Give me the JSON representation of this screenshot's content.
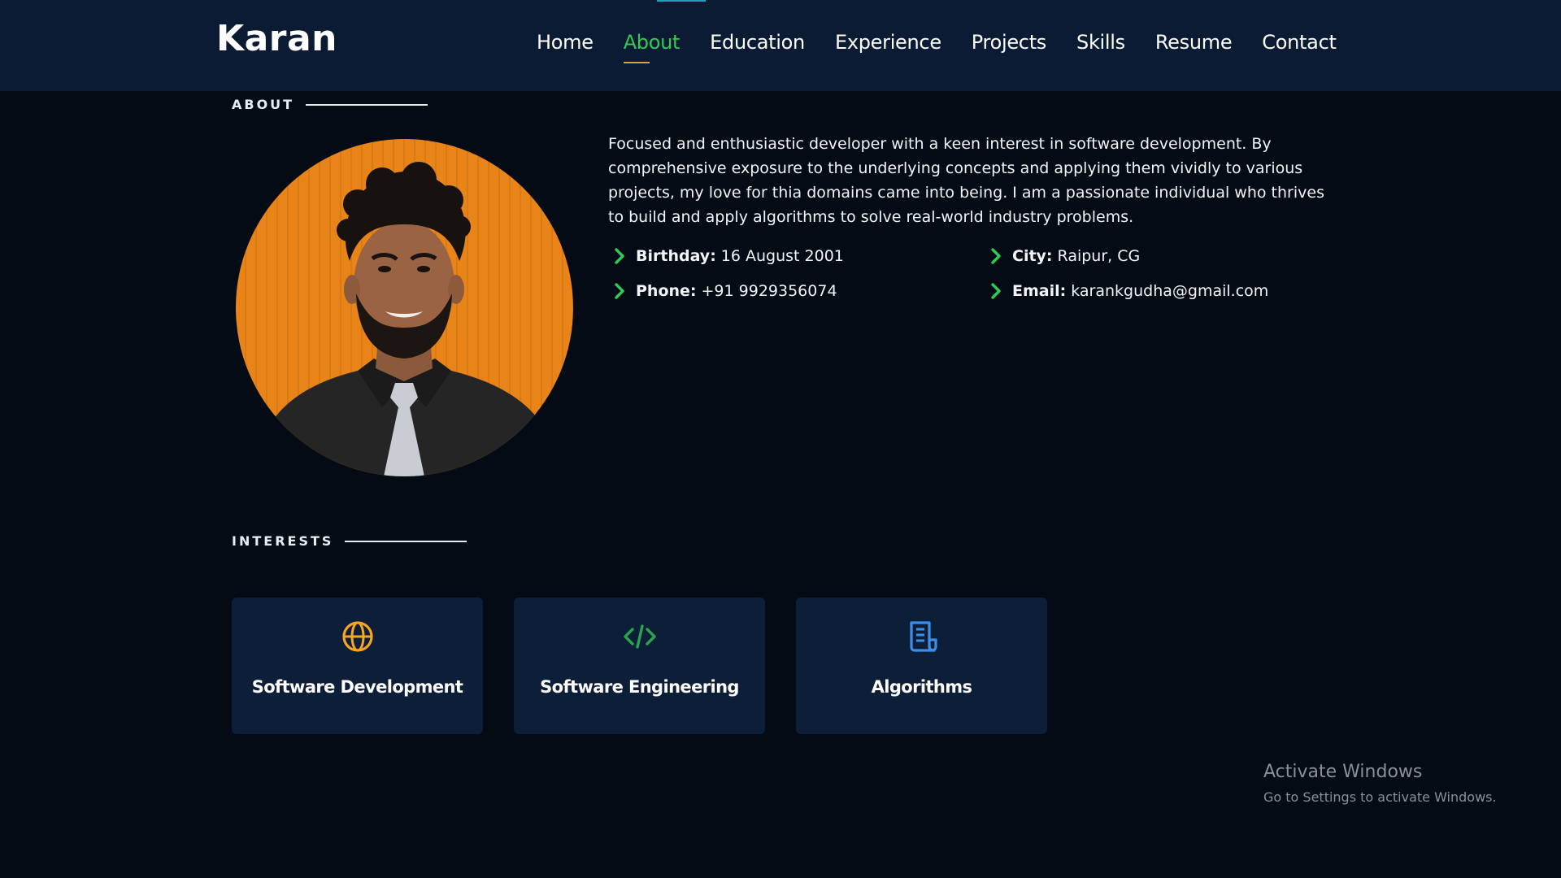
{
  "header": {
    "logo": "Karan",
    "nav": [
      {
        "label": "Home",
        "active": false
      },
      {
        "label": "About",
        "active": true
      },
      {
        "label": "Education",
        "active": false
      },
      {
        "label": "Experience",
        "active": false
      },
      {
        "label": "Projects",
        "active": false
      },
      {
        "label": "Skills",
        "active": false
      },
      {
        "label": "Resume",
        "active": false
      },
      {
        "label": "Contact",
        "active": false
      }
    ]
  },
  "about": {
    "title": "ABOUT",
    "bio": "Focused and enthusiastic developer with a keen interest in software development. By comprehensive exposure to the underlying concepts and applying them vividly to various projects, my love for thia domains came into being. I am a passionate individual who thrives to build and apply algorithms to solve real-world industry problems.",
    "info": {
      "birthday": {
        "key": "Birthday:",
        "value": "16 August 2001"
      },
      "city": {
        "key": "City:",
        "value": "Raipur, CG"
      },
      "phone": {
        "key": "Phone:",
        "value": "+91 9929356074"
      },
      "email": {
        "key": "Email:",
        "value": "karankgudha@gmail.com"
      }
    }
  },
  "interests": {
    "title": "INTERESTS",
    "items": [
      {
        "label": "Software Development",
        "icon": "globe-icon",
        "color": "#f5a623"
      },
      {
        "label": "Software Engineering",
        "icon": "code-icon",
        "color": "#2aa44f"
      },
      {
        "label": "Algorithms",
        "icon": "document-icon",
        "color": "#3b8fe8"
      }
    ]
  },
  "watermark": {
    "title": "Activate Windows",
    "subtitle": "Go to Settings to activate Windows."
  },
  "colors": {
    "background": "#040b14",
    "header": "#0a1b33",
    "card": "#0d1e38",
    "accent_green": "#2ecc54",
    "underline_gold": "#d9a441"
  }
}
